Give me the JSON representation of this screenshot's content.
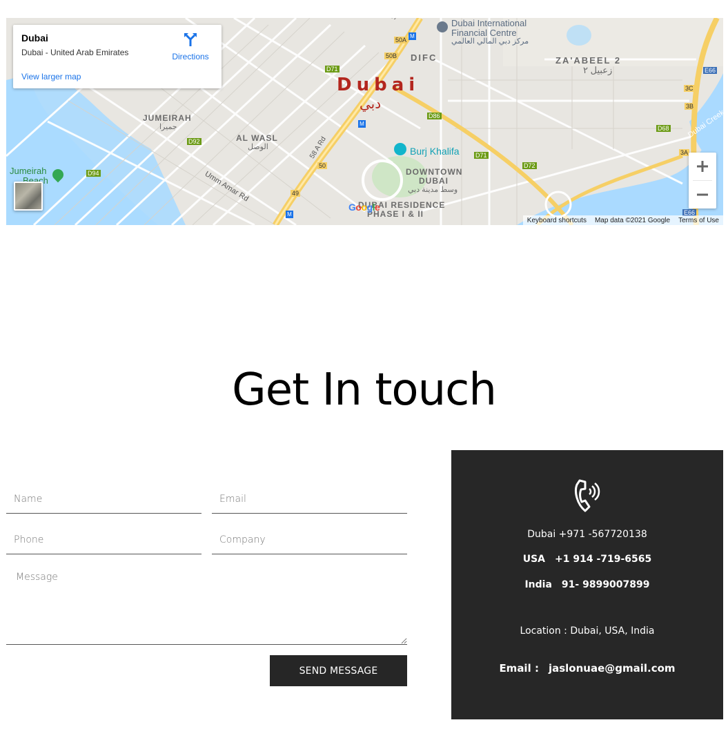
{
  "map": {
    "place_title": "Dubai",
    "place_address": "Dubai - United Arab Emirates",
    "larger_map_link": "View larger map",
    "directions_label": "Directions",
    "city_label_en": "Dubai",
    "city_label_ar": "دبي",
    "labels": {
      "difc": "DIFC",
      "dubai_intl_fin_centre_1": "Dubai International",
      "dubai_intl_fin_centre_2": "Financial Centre",
      "dubai_intl_fin_centre_ar": "مركز دبي المالي العالمي",
      "zabeel": "ZA'ABEEL 2",
      "zabeel_ar": "زعبيل ٢",
      "jumeirah": "JUMEIRAH",
      "jumeirah_ar": "جميرا",
      "al_wasl": "AL WASL",
      "al_wasl_ar": "الوصل",
      "umm_amar": "Umm Amar Rd",
      "road_58a": "58 A Rd",
      "burj_khalifa": "Burj Khalifa",
      "downtown_1": "DOWNTOWN",
      "downtown_2": "DUBAI",
      "downtown_ar": "وسط مدينة دبي",
      "residence_1": "DUBAI RESIDENCE",
      "residence_2": "PHASE I & II",
      "jumeirah_beach_1": "Jumeirah",
      "jumeirah_beach_2": "Beach",
      "dubai_creek": "Dubai Creek",
      "road_306": "306",
      "road_d71a": "D71",
      "road_d71b": "D71",
      "road_d86": "D86",
      "road_d92": "D92",
      "road_d94": "D94",
      "road_d72": "D72",
      "road_d68": "D68",
      "road_50a": "50A",
      "road_50b": "50B",
      "road_50": "50",
      "road_49": "49",
      "road_3c": "3C",
      "road_3b": "3B",
      "road_3a": "3A",
      "road_e66a": "E66",
      "road_e66b": "E66"
    },
    "google_logo": "Google",
    "footer_shortcuts": "Keyboard shortcuts",
    "footer_data": "Map data ©2021 Google",
    "footer_terms": "Terms of Use",
    "zoom_in": "+",
    "zoom_out": "−"
  },
  "heading": "Get In touch",
  "form": {
    "name_placeholder": "Name",
    "email_placeholder": "Email",
    "phone_placeholder": "Phone",
    "company_placeholder": "Company",
    "message_placeholder": "Message",
    "send_label": "SEND MESSAGE"
  },
  "contact": {
    "phone_icon": "phone-icon",
    "dubai_line": "Dubai +971 -567720138",
    "usa_label": "USA",
    "usa_number": "+1 914 -719-6565",
    "india_label": "India",
    "india_number": "91- 9899007899",
    "location_line": "Location : Dubai, USA, India",
    "email_label": "Email :",
    "email_value": "jaslonuae@gmail.com"
  },
  "colors": {
    "panel_bg": "#272727",
    "button_bg": "#262626",
    "map_link_blue": "#1a73e8",
    "map_city_red": "#b3261e"
  }
}
